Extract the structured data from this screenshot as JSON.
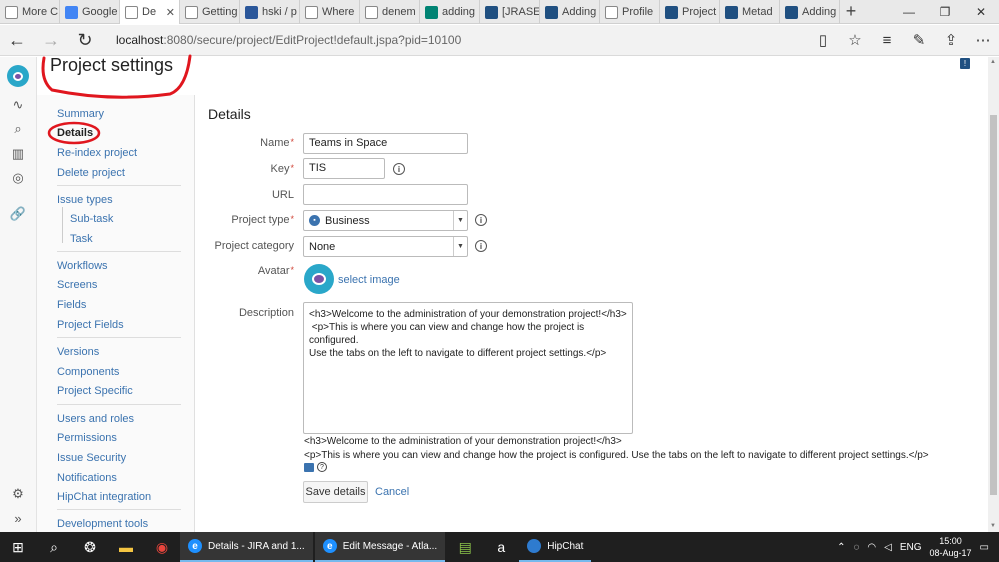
{
  "browser": {
    "tabs": [
      {
        "title": "More C",
        "icon": "page-icon",
        "active": false
      },
      {
        "title": "Google",
        "icon": "google-icon",
        "active": false
      },
      {
        "title": "De",
        "icon": "page-icon",
        "active": true
      },
      {
        "title": "Getting",
        "icon": "page-icon",
        "active": false
      },
      {
        "title": "hski / p",
        "icon": "bitbucket-icon",
        "active": false
      },
      {
        "title": "Where",
        "icon": "page-icon",
        "active": false
      },
      {
        "title": "denem",
        "icon": "page-icon",
        "active": false
      },
      {
        "title": "adding",
        "icon": "bing-icon",
        "active": false
      },
      {
        "title": "[JRASE",
        "icon": "jira-icon",
        "active": false
      },
      {
        "title": "Adding",
        "icon": "jira-icon",
        "active": false
      },
      {
        "title": "Profile",
        "icon": "page-icon",
        "active": false
      },
      {
        "title": "Project",
        "icon": "jira-icon",
        "active": false
      },
      {
        "title": "Metad",
        "icon": "jira-icon",
        "active": false
      },
      {
        "title": "Adding",
        "icon": "jira-icon",
        "active": false
      }
    ],
    "url_host": "localhost",
    "url_path": ":8080/secure/project/EditProject!default.jspa?pid=10100"
  },
  "page": {
    "title": "Project settings",
    "heading": "Details"
  },
  "nav": {
    "summary": "Summary",
    "details": "Details",
    "reindex": "Re-index project",
    "delete": "Delete project",
    "issue_types": "Issue types",
    "subtask": "Sub-task",
    "task": "Task",
    "workflows": "Workflows",
    "screens": "Screens",
    "fields": "Fields",
    "project_fields": "Project Fields",
    "versions": "Versions",
    "components": "Components",
    "project_specific": "Project Specific",
    "users_roles": "Users and roles",
    "permissions": "Permissions",
    "issue_security": "Issue Security",
    "notifications": "Notifications",
    "hipchat": "HipChat integration",
    "dev_tools": "Development tools"
  },
  "form": {
    "name_label": "Name",
    "name_value": "Teams in Space",
    "key_label": "Key",
    "key_value": "TIS",
    "url_label": "URL",
    "url_value": "",
    "type_label": "Project type",
    "type_value": "Business",
    "category_label": "Project category",
    "category_value": "None",
    "avatar_label": "Avatar",
    "select_image": "select image",
    "description_label": "Description",
    "description_value": "<h3>Welcome to the administration of your demonstration project!</h3>\n <p>This is where you can view and change how the project is configured.\nUse the tabs on the left to navigate to different project settings.</p>",
    "preview_line1": "<h3>Welcome to the administration of your demonstration project!</h3>",
    "preview_line2": "<p>This is where you can view and change how the project is configured. Use the tabs on the left to navigate to different project settings.</p>",
    "save_label": "Save details",
    "cancel_label": "Cancel"
  },
  "taskbar": {
    "app1": "Details - JIRA and 1...",
    "app2": "Edit Message - Atla...",
    "app3": "HipChat",
    "lang": "ENG",
    "time": "15:00",
    "date": "08-Aug-17"
  },
  "colors": {
    "link": "#3b73af",
    "required": "#d04437",
    "annotation": "#e0161e"
  }
}
